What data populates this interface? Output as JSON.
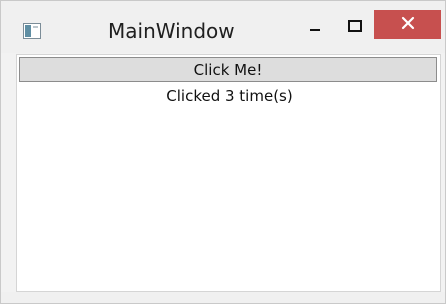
{
  "window": {
    "title": "MainWindow",
    "close_color": "#c7504f"
  },
  "icons": {
    "app": "app-window-icon",
    "minimize": "minimize-icon",
    "maximize": "maximize-icon",
    "close": "close-icon"
  },
  "content": {
    "button_label": "Click Me!",
    "status_text": "Clicked 3 time(s)"
  }
}
